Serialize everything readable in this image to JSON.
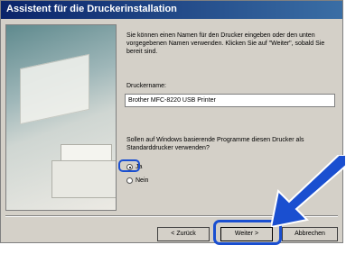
{
  "title": "Assistent für die Druckerinstallation",
  "intro": "Sie können einen Namen für den Drucker eingeben oder den unten vorgegebenen Namen verwenden. Klicken Sie auf \"Weiter\", sobald Sie bereit sind.",
  "printer_name_label": "Druckername:",
  "printer_name_value": "Brother MFC-8220 USB Printer",
  "default_question": "Sollen auf Windows basierende Programme diesen Drucker als Standarddrucker verwenden?",
  "options": [
    {
      "label": "Ja",
      "selected": true
    },
    {
      "label": "Nein",
      "selected": false
    }
  ],
  "buttons": {
    "back": "< Zurück",
    "next": "Weiter >",
    "cancel": "Abbrechen"
  },
  "highlight_color": "#1a4fd0"
}
